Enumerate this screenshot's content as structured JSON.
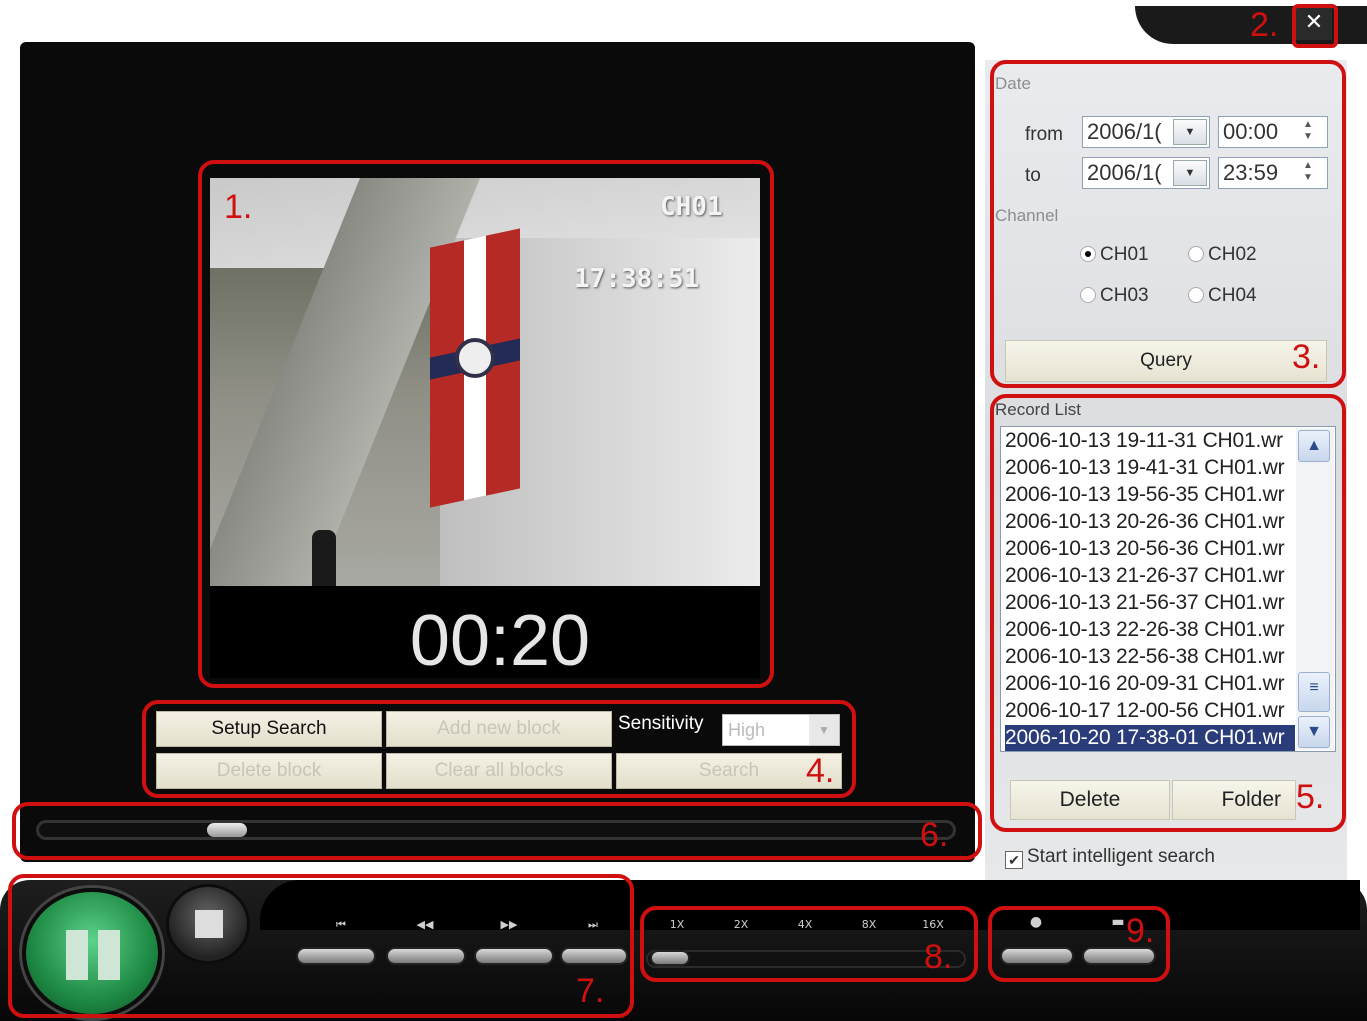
{
  "window": {
    "close_label": "✕"
  },
  "video": {
    "channel_osd": "CH01",
    "time_osd": "17:38:51",
    "playback_time": "00:20"
  },
  "block_controls": {
    "setup_search": "Setup Search",
    "add_new_block": "Add new block",
    "sensitivity_label": "Sensitivity",
    "sensitivity_value": "High",
    "delete_block": "Delete block",
    "clear_all_blocks": "Clear all blocks",
    "search": "Search"
  },
  "seek": {
    "position_fraction": 0.19
  },
  "date_group": {
    "label": "Date",
    "from_label": "from",
    "to_label": "to",
    "from_date": "2006/1(",
    "from_time": "00:00",
    "to_date": "2006/1(",
    "to_time": "23:59"
  },
  "channel_group": {
    "label": "Channel",
    "options": [
      {
        "label": "CH01",
        "selected": true
      },
      {
        "label": "CH02",
        "selected": false
      },
      {
        "label": "CH03",
        "selected": false
      },
      {
        "label": "CH04",
        "selected": false
      }
    ]
  },
  "query_label": "Query",
  "record_list": {
    "label": "Record List",
    "items": [
      "2006-10-13 19-11-31 CH01.wr",
      "2006-10-13 19-41-31 CH01.wr",
      "2006-10-13 19-56-35 CH01.wr",
      "2006-10-13 20-26-36 CH01.wr",
      "2006-10-13 20-56-36 CH01.wr",
      "2006-10-13 21-26-37 CH01.wr",
      "2006-10-13 21-56-37 CH01.wr",
      "2006-10-13 22-26-38 CH01.wr",
      "2006-10-13 22-56-38 CH01.wr",
      "2006-10-16 20-09-31 CH01.wr",
      "2006-10-17 12-00-56 CH01.wr",
      "2006-10-20 17-38-01 CH01.wr"
    ],
    "selected_index": 11
  },
  "list_actions": {
    "delete": "Delete",
    "folder": "Folder"
  },
  "intelligent_search": {
    "label": "Start intelligent search",
    "checked": true
  },
  "transport": {
    "nav_labels": [
      "⏮",
      "◀◀",
      "▶▶",
      "⏭"
    ],
    "speed_labels": [
      "1X",
      "2X",
      "4X",
      "8X",
      "16X"
    ]
  },
  "annotations": [
    "1.",
    "2.",
    "3.",
    "4.",
    "5.",
    "6.",
    "7.",
    "8.",
    "9."
  ],
  "colors": {
    "annotation": "#d01010",
    "play_green": "#1e8a44",
    "selection": "#2a3c7a"
  }
}
